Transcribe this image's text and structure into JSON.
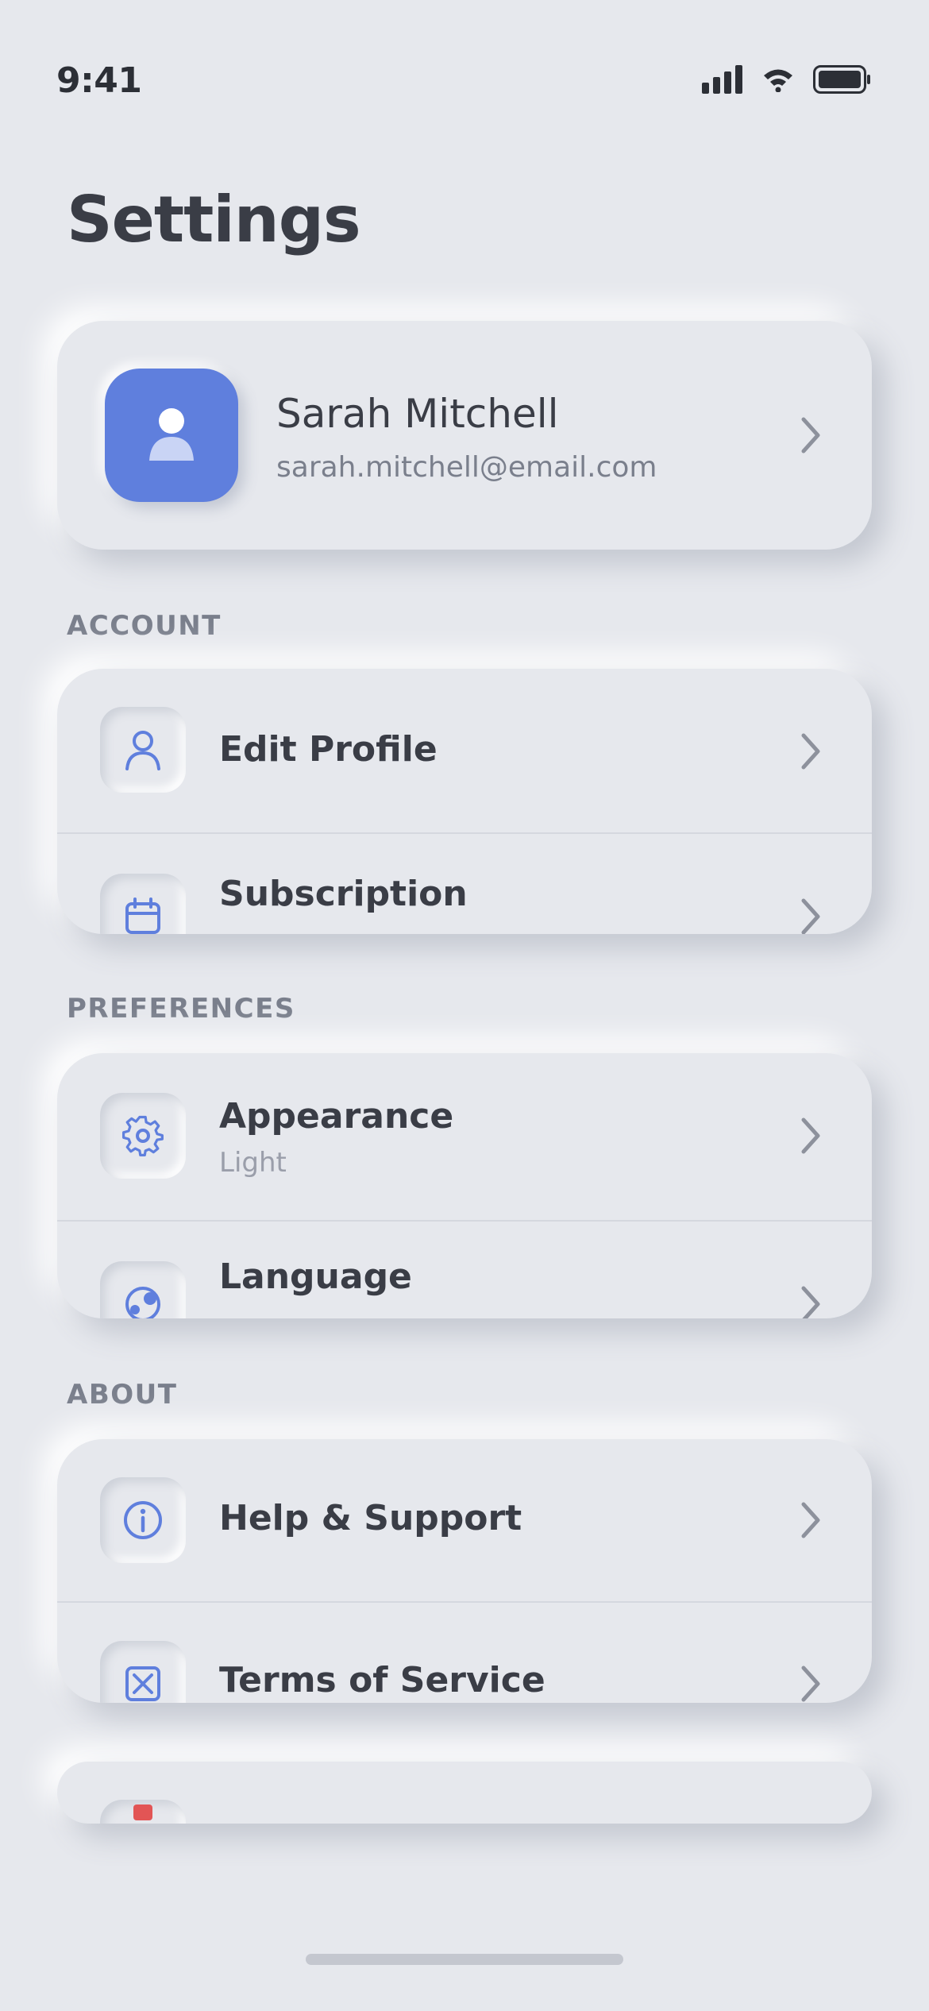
{
  "status_bar": {
    "time": "9:41",
    "icons": [
      "signal-icon",
      "wifi-icon",
      "battery-icon"
    ]
  },
  "page": {
    "title": "Settings"
  },
  "profile": {
    "name": "Sarah Mitchell",
    "email": "sarah.mitchell@email.com",
    "avatar_icon": "user-silhouette-icon",
    "avatar_color": "#5f7fdd"
  },
  "sections": {
    "account": {
      "label": "ACCOUNT",
      "items": [
        {
          "label": "Edit Profile",
          "icon": "user-icon"
        },
        {
          "label": "Subscription",
          "icon": "calendar-icon"
        }
      ]
    },
    "preferences": {
      "label": "PREFERENCES",
      "items": [
        {
          "label": "Appearance",
          "value": "Light",
          "icon": "gear-icon"
        },
        {
          "label": "Language",
          "icon": "globe-icon"
        }
      ]
    },
    "about": {
      "label": "ABOUT",
      "items": [
        {
          "label": "Help & Support",
          "icon": "info-icon"
        },
        {
          "label": "Terms of Service",
          "icon": "document-x-icon"
        }
      ]
    }
  },
  "colors": {
    "background": "#e6e8ed",
    "accent": "#5f7fdd",
    "text_primary": "#3a3d46",
    "text_secondary": "#7a7f8c",
    "danger": "#e25555"
  }
}
